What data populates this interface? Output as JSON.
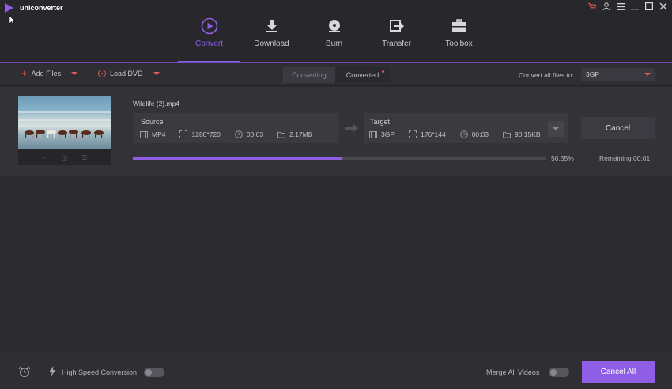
{
  "app": {
    "name": "uniconverter"
  },
  "nav": {
    "items": [
      {
        "label": "Convert",
        "icon": "play-circle-icon",
        "active": true
      },
      {
        "label": "Download",
        "icon": "download-icon",
        "active": false
      },
      {
        "label": "Burn",
        "icon": "disc-icon",
        "active": false
      },
      {
        "label": "Transfer",
        "icon": "transfer-icon",
        "active": false
      },
      {
        "label": "Toolbox",
        "icon": "toolbox-icon",
        "active": false
      }
    ]
  },
  "window_controls": [
    "cart-icon",
    "user-icon",
    "menu-icon",
    "minimize-icon",
    "maximize-icon",
    "close-icon"
  ],
  "toolbar": {
    "add_files": "Add Files",
    "load_dvd": "Load DVD",
    "tab_converting": "Converting",
    "tab_converted": "Converted",
    "convert_all_label": "Convert all files to:",
    "convert_all_value": "3GP"
  },
  "file": {
    "name": "Wildlife (2).mp4",
    "source": {
      "title": "Source",
      "format": "MP4",
      "resolution": "1280*720",
      "duration": "00:03",
      "size": "2.17MB"
    },
    "target": {
      "title": "Target",
      "format": "3GP",
      "resolution": "176*144",
      "duration": "00:03",
      "size": "90.15KB"
    },
    "cancel_label": "Cancel",
    "progress_percent": 50.55,
    "progress_text": "50.55%",
    "remaining": "Remaining:00:01"
  },
  "footer": {
    "high_speed_label": "High Speed Conversion",
    "merge_label": "Merge All Videos",
    "cancel_all_label": "Cancel All"
  },
  "colors": {
    "accent": "#8e5ee6",
    "red": "#e15b55",
    "background": "#2b2a2e"
  }
}
